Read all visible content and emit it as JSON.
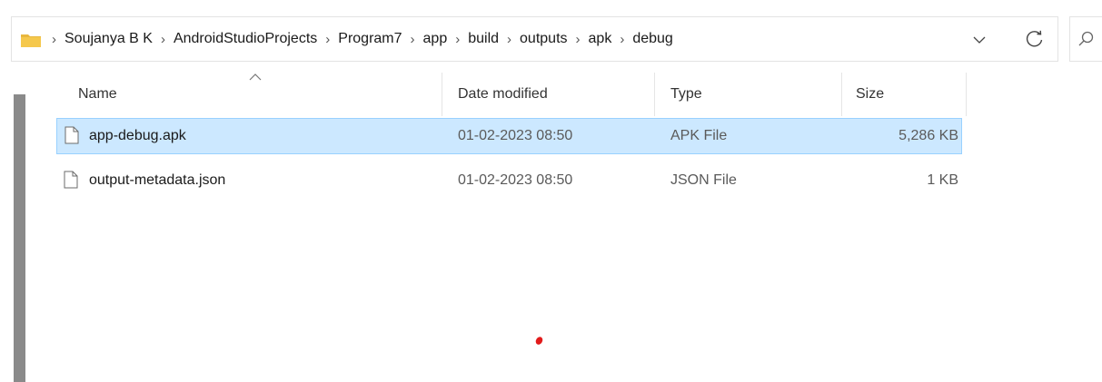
{
  "address_bar": {
    "crumbs": [
      "Soujanya B K",
      "AndroidStudioProjects",
      "Program7",
      "app",
      "build",
      "outputs",
      "apk",
      "debug"
    ],
    "separator": "›",
    "icons": [
      "folder-icon",
      "chevron-down-icon",
      "refresh-icon",
      "search-icon"
    ]
  },
  "columns": {
    "name": "Name",
    "date_modified": "Date modified",
    "type": "Type",
    "size": "Size"
  },
  "files": [
    {
      "name": "app-debug.apk",
      "date_modified": "01-02-2023 08:50",
      "type": "APK File",
      "size": "5,286 KB",
      "selected": true
    },
    {
      "name": "output-metadata.json",
      "date_modified": "01-02-2023 08:50",
      "type": "JSON File",
      "size": "1 KB",
      "selected": false
    }
  ],
  "colors": {
    "selection_bg": "#cce8ff",
    "selection_border": "#99d1ff",
    "folder": "#f2c14e",
    "annotation_dot": "#e21b1b"
  }
}
